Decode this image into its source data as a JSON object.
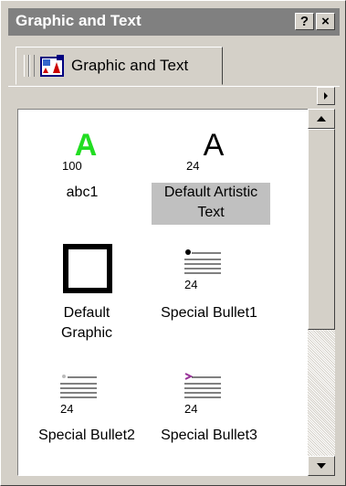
{
  "window": {
    "title": "Graphic and Text",
    "help_button": "?",
    "close_button": "×"
  },
  "tab": {
    "label": "Graphic and Text"
  },
  "items": [
    {
      "label": "abc1",
      "size": "100",
      "preview_glyph": "A",
      "preview_color": "#22dd22",
      "selected": false
    },
    {
      "label_lines": [
        "Default Artistic",
        "Text"
      ],
      "size": "24",
      "preview_glyph": "A",
      "preview_color": "#000000",
      "selected": true
    },
    {
      "label_lines": [
        "Default",
        "Graphic"
      ],
      "preview": "square-frame",
      "selected": false
    },
    {
      "label": "Special Bullet1",
      "size": "24",
      "preview": "bullet-lines",
      "bullet_color": "#000000",
      "selected": false
    },
    {
      "label": "Special Bullet2",
      "size": "24",
      "preview": "bullet-lines",
      "bullet_color": "#bbbbbb",
      "selected": false
    },
    {
      "label": "Special Bullet3",
      "size": "24",
      "preview": "bullet-lines",
      "bullet_color": "#993399",
      "selected": false
    }
  ]
}
